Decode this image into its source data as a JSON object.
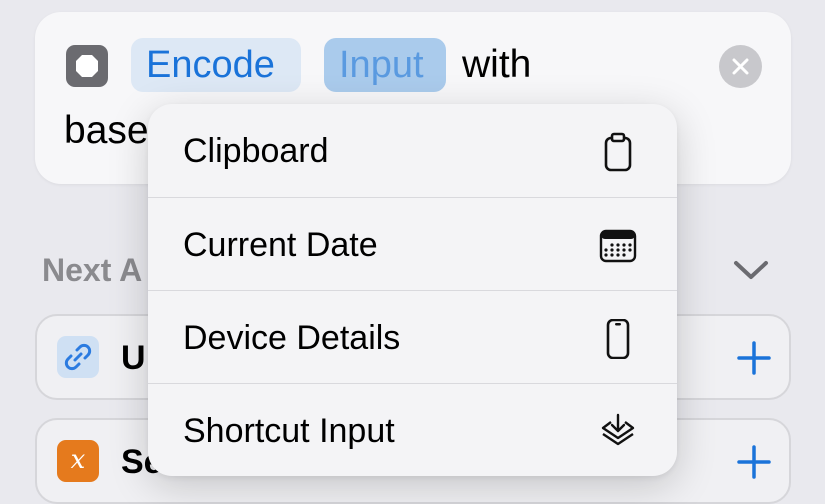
{
  "action": {
    "icon": "stop-square-icon",
    "verb": "Encode",
    "variable": "Input",
    "with_text": "with",
    "line2_text": "base",
    "clear_icon": "clear-x-icon"
  },
  "next_actions": {
    "title": "Next A",
    "chevron_icon": "chevron-down-icon",
    "rows": [
      {
        "label": "U",
        "icon": "link-icon",
        "add_icon": "plus-icon"
      },
      {
        "label": "Se",
        "icon_text": "x",
        "icon": "variable-x-icon",
        "add_icon": "plus-icon"
      }
    ]
  },
  "menu": {
    "items": [
      {
        "label": "Clipboard",
        "icon": "clipboard-icon"
      },
      {
        "label": "Current Date",
        "icon": "calendar-icon"
      },
      {
        "label": "Device Details",
        "icon": "iphone-icon"
      },
      {
        "label": "Shortcut Input",
        "icon": "shortcut-input-icon"
      }
    ]
  },
  "colors": {
    "accent": "#1a73d9",
    "variable_chip": "#aacbec",
    "action_icon": "#6b6b70",
    "variable_icon_orange": "#e57a1d"
  }
}
